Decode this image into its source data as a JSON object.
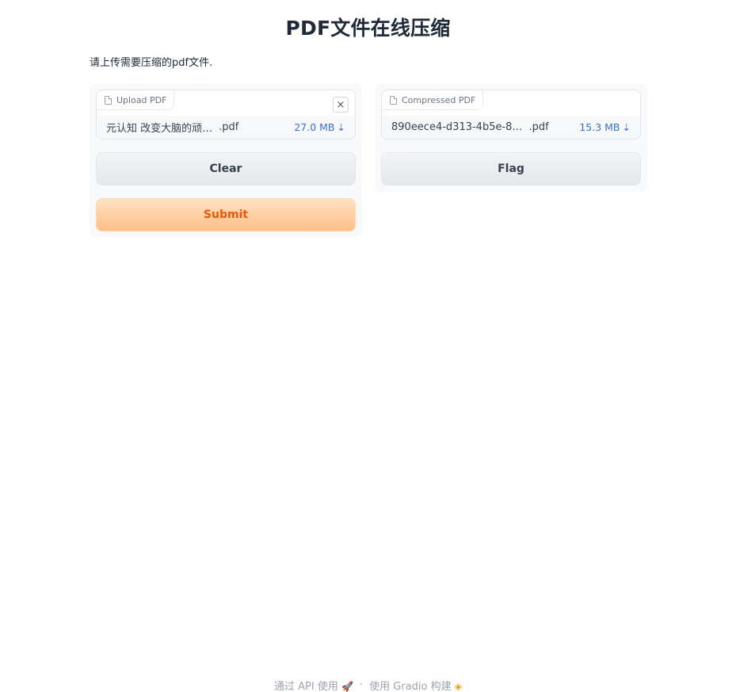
{
  "page": {
    "title": "PDF文件在线压缩",
    "description": "请上传需要压缩的pdf文件."
  },
  "input_panel": {
    "label": "Upload PDF",
    "file_name": "元认知 改变大脑的顽…",
    "file_ext": ".pdf",
    "file_size": "27.0 MB",
    "download_glyph": "⇣",
    "close_glyph": "×",
    "clear_label": "Clear",
    "submit_label": "Submit"
  },
  "output_panel": {
    "label": "Compressed PDF",
    "file_name": "890eece4-d313-4b5e-8…",
    "file_ext": ".pdf",
    "file_size": "15.3 MB",
    "download_glyph": "⇣",
    "flag_label": "Flag"
  },
  "footer": {
    "api_label": "通过 API 使用",
    "separator": "·",
    "built_with": "使用 Gradio 构建",
    "rocket_icon": "🚀",
    "gradio_icon": "◈"
  },
  "colors": {
    "primary_text": "#ea580c",
    "link_blue": "#3b6fd1",
    "primary_gradient_start": "#ffe2c4",
    "primary_gradient_end": "#ffbe84"
  }
}
